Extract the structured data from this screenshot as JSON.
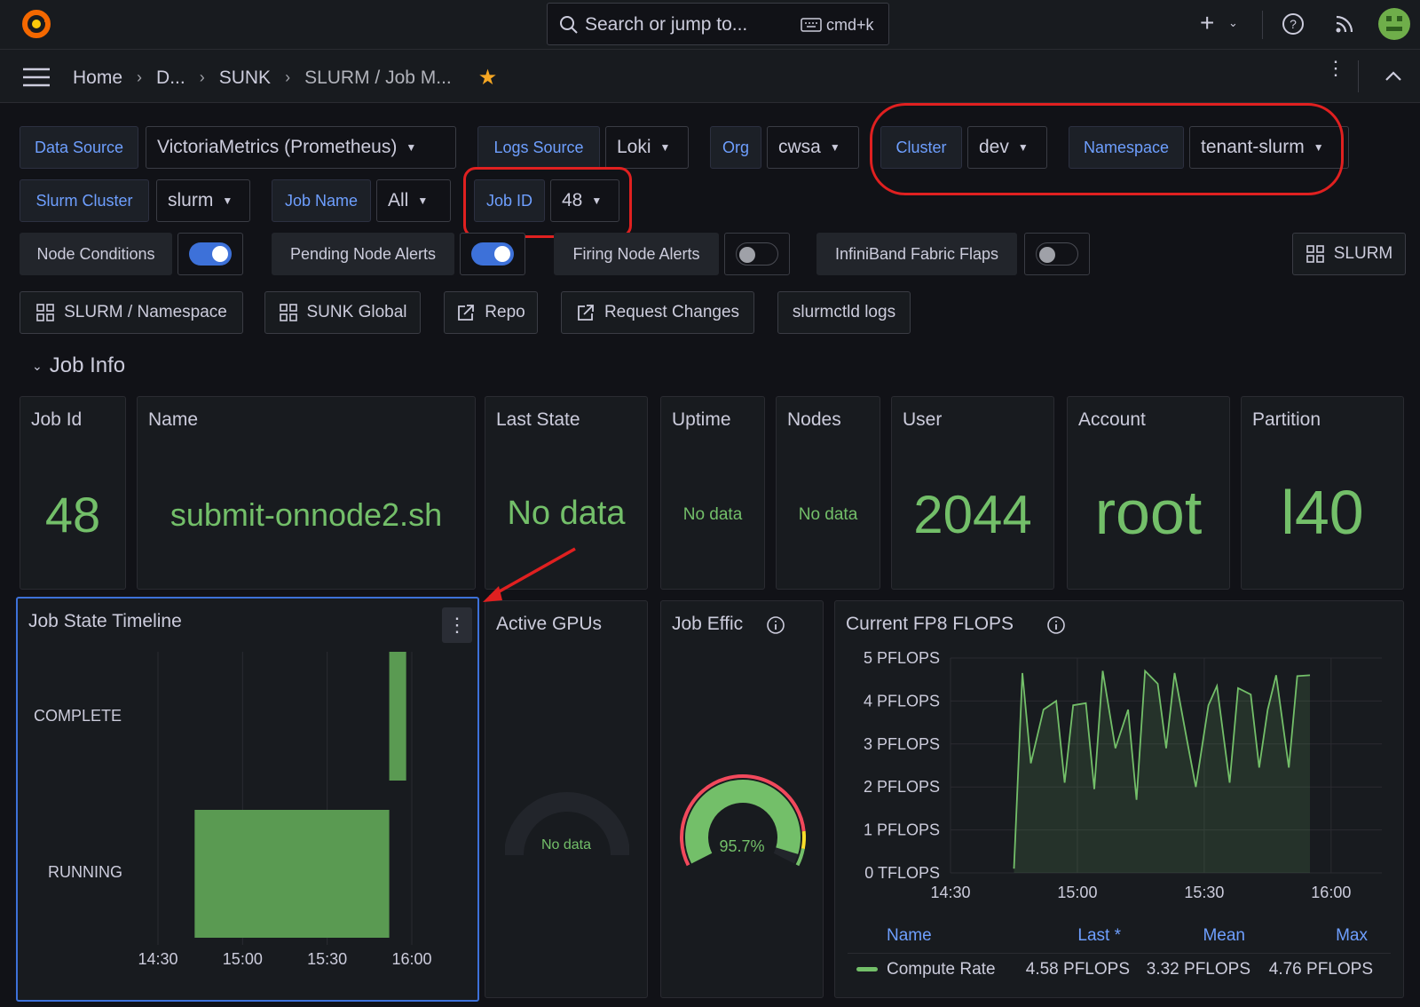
{
  "topbar": {
    "search_placeholder": "Search or jump to...",
    "shortcut": "cmd+k",
    "icons": [
      "grafana-logo-icon",
      "search-icon",
      "keyboard-icon",
      "plus-icon",
      "help-icon",
      "rss-icon",
      "avatar"
    ]
  },
  "breadcrumb": {
    "items": [
      "Home",
      "D...",
      "SUNK",
      "SLURM / Job M..."
    ]
  },
  "variables": {
    "data_source": {
      "label": "Data Source",
      "value": "VictoriaMetrics (Prometheus)"
    },
    "logs_source": {
      "label": "Logs Source",
      "value": "Loki"
    },
    "org": {
      "label": "Org",
      "value": "cwsa"
    },
    "cluster": {
      "label": "Cluster",
      "value": "dev"
    },
    "namespace": {
      "label": "Namespace",
      "value": "tenant-slurm"
    },
    "slurm_cluster": {
      "label": "Slurm Cluster",
      "value": "slurm"
    },
    "job_name": {
      "label": "Job Name",
      "value": "All"
    },
    "job_id": {
      "label": "Job ID",
      "value": "48"
    }
  },
  "toggles": {
    "node_conditions": {
      "label": "Node Conditions",
      "on": true
    },
    "pending_node_alerts": {
      "label": "Pending Node Alerts",
      "on": true
    },
    "firing_node_alerts": {
      "label": "Firing Node Alerts",
      "on": false
    },
    "infiniband_flaps": {
      "label": "InfiniBand Fabric Flaps",
      "on": false
    }
  },
  "links": {
    "slurm": "SLURM",
    "slurm_namespace": "SLURM / Namespace",
    "sunk_global": "SUNK Global",
    "repo": "Repo",
    "request_changes": "Request Changes",
    "slurmctld_logs": "slurmctld logs"
  },
  "row": {
    "title": "Job Info"
  },
  "stats": {
    "job_id": {
      "title": "Job Id",
      "value": "48"
    },
    "name": {
      "title": "Name",
      "value": "submit-onnode2.sh"
    },
    "last_state": {
      "title": "Last State",
      "value": "No data"
    },
    "uptime": {
      "title": "Uptime",
      "value": "No data"
    },
    "nodes": {
      "title": "Nodes",
      "value": "No data"
    },
    "user": {
      "title": "User",
      "value": "2044"
    },
    "account": {
      "title": "Account",
      "value": "root"
    },
    "partition": {
      "title": "Partition",
      "value": "l40"
    }
  },
  "panels": {
    "timeline_title": "Job State Timeline",
    "active_gpus": {
      "title": "Active GPUs",
      "value": "No data"
    },
    "job_eff": {
      "title": "Job Effic",
      "value": "95.7%",
      "fraction": 0.957
    },
    "flops_title": "Current FP8 FLOPS"
  },
  "legend": {
    "headers": [
      "Name",
      "Last *",
      "Mean",
      "Max"
    ],
    "series": "Compute Rate",
    "last": "4.58 PFLOPS",
    "mean": "3.32 PFLOPS",
    "max": "4.76 PFLOPS"
  },
  "chart_data": [
    {
      "type": "bar",
      "title": "Job State Timeline",
      "categories": [
        "COMPLETE",
        "RUNNING"
      ],
      "x_ticks": [
        "14:30",
        "15:00",
        "15:30",
        "16:00"
      ],
      "series": [
        {
          "name": "RUNNING",
          "start": "14:43",
          "end": "15:52"
        },
        {
          "name": "COMPLETE",
          "start": "15:52",
          "end": "15:58"
        }
      ],
      "colors": {
        "bar": "#5a9a52"
      }
    },
    {
      "type": "area",
      "title": "Current FP8 FLOPS",
      "ylabel": "",
      "y_ticks": [
        "0 TFLOPS",
        "1 PFLOPS",
        "2 PFLOPS",
        "3 PFLOPS",
        "4 PFLOPS",
        "5 PFLOPS"
      ],
      "x_ticks": [
        "14:30",
        "15:00",
        "15:30",
        "16:00"
      ],
      "ylim": [
        0,
        5
      ],
      "series": [
        {
          "name": "Compute Rate",
          "x": [
            "14:45",
            "14:47",
            "14:49",
            "14:52",
            "14:55",
            "14:57",
            "14:59",
            "15:02",
            "15:04",
            "15:06",
            "15:09",
            "15:12",
            "15:14",
            "15:16",
            "15:19",
            "15:21",
            "15:23",
            "15:26",
            "15:28",
            "15:31",
            "15:33",
            "15:36",
            "15:38",
            "15:41",
            "15:43",
            "15:45",
            "15:47",
            "15:50",
            "15:52",
            "15:55"
          ],
          "y": [
            0.1,
            4.65,
            2.55,
            3.8,
            4.0,
            2.1,
            3.9,
            3.95,
            1.95,
            4.7,
            2.9,
            3.8,
            1.7,
            4.7,
            4.4,
            2.9,
            4.65,
            3.05,
            2.0,
            3.9,
            4.35,
            2.1,
            4.3,
            4.15,
            2.45,
            3.8,
            4.6,
            2.45,
            4.58,
            4.6
          ],
          "color": "#73bf69"
        }
      ]
    }
  ]
}
